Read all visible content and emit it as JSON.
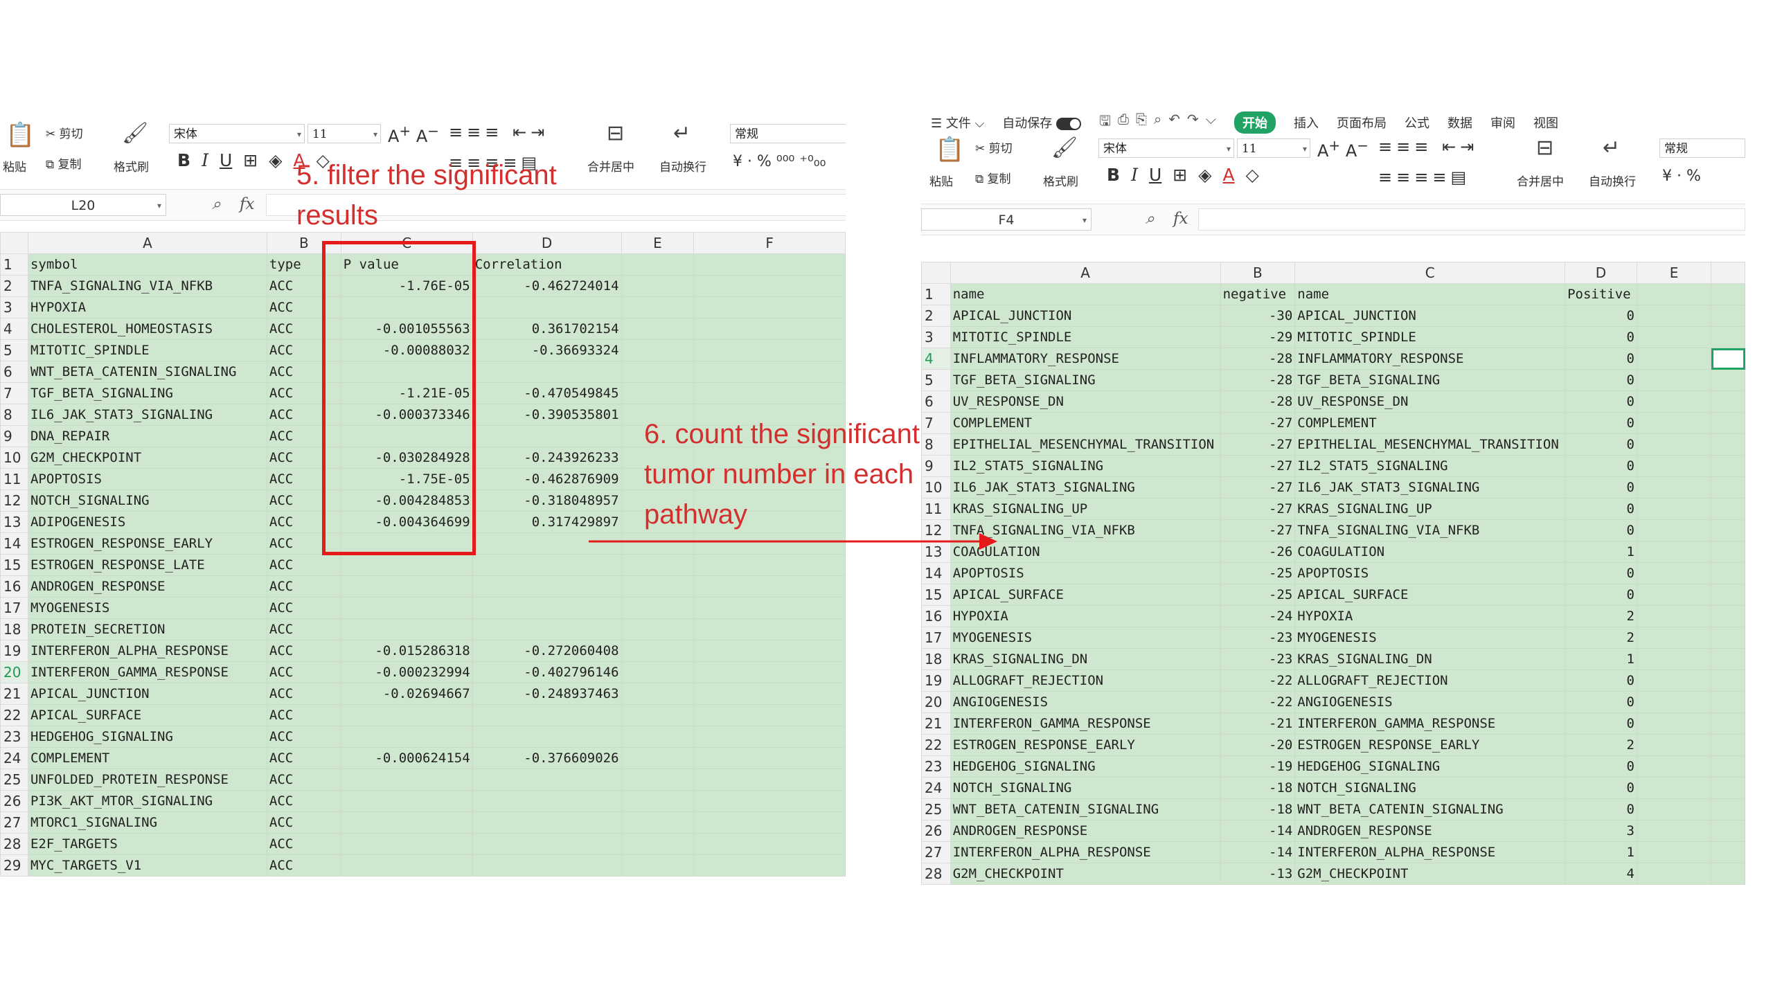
{
  "annotations": {
    "step5_line1": "5. filter the significant",
    "step5_line2": "results",
    "step6_line1": "6. count the significant",
    "step6_line2": "tumor number in each",
    "step6_line3": "pathway"
  },
  "colors": {
    "annotation": "#d32f2f",
    "highlight_box": "#e51a1a",
    "cell_fill": "#cfe7cf",
    "accent": "#21a366"
  },
  "left_sheet": {
    "ribbon": {
      "paste": "粘贴",
      "cut": "剪切",
      "copy": "复制",
      "format_painter": "格式刷",
      "font_name": "宋体",
      "font_size": "11",
      "merge_center": "合并居中",
      "wrap_text": "自动换行",
      "number_format": "常规"
    },
    "name_box": "L20",
    "col_headers": [
      "A",
      "B",
      "C",
      "D",
      "E",
      "F"
    ],
    "rows": [
      {
        "n": "1",
        "a": "symbol",
        "b": "type",
        "c": "P value",
        "d": "Correlation"
      },
      {
        "n": "2",
        "a": "TNFA_SIGNALING_VIA_NFKB",
        "b": "ACC",
        "c": "-1.76E-05",
        "d": "-0.462724014"
      },
      {
        "n": "3",
        "a": "HYPOXIA",
        "b": "ACC",
        "c": "",
        "d": ""
      },
      {
        "n": "4",
        "a": "CHOLESTEROL_HOMEOSTASIS",
        "b": "ACC",
        "c": "-0.001055563",
        "d": "0.361702154"
      },
      {
        "n": "5",
        "a": "MITOTIC_SPINDLE",
        "b": "ACC",
        "c": "-0.00088032",
        "d": "-0.36693324"
      },
      {
        "n": "6",
        "a": "WNT_BETA_CATENIN_SIGNALING",
        "b": "ACC",
        "c": "",
        "d": ""
      },
      {
        "n": "7",
        "a": "TGF_BETA_SIGNALING",
        "b": "ACC",
        "c": "-1.21E-05",
        "d": "-0.470549845"
      },
      {
        "n": "8",
        "a": "IL6_JAK_STAT3_SIGNALING",
        "b": "ACC",
        "c": "-0.000373346",
        "d": "-0.390535801"
      },
      {
        "n": "9",
        "a": "DNA_REPAIR",
        "b": "ACC",
        "c": "",
        "d": ""
      },
      {
        "n": "10",
        "a": "G2M_CHECKPOINT",
        "b": "ACC",
        "c": "-0.030284928",
        "d": "-0.243926233"
      },
      {
        "n": "11",
        "a": "APOPTOSIS",
        "b": "ACC",
        "c": "-1.75E-05",
        "d": "-0.462876909"
      },
      {
        "n": "12",
        "a": "NOTCH_SIGNALING",
        "b": "ACC",
        "c": "-0.004284853",
        "d": "-0.318048957"
      },
      {
        "n": "13",
        "a": "ADIPOGENESIS",
        "b": "ACC",
        "c": "-0.004364699",
        "d": "0.317429897"
      },
      {
        "n": "14",
        "a": "ESTROGEN_RESPONSE_EARLY",
        "b": "ACC",
        "c": "",
        "d": ""
      },
      {
        "n": "15",
        "a": "ESTROGEN_RESPONSE_LATE",
        "b": "ACC",
        "c": "",
        "d": ""
      },
      {
        "n": "16",
        "a": "ANDROGEN_RESPONSE",
        "b": "ACC",
        "c": "",
        "d": ""
      },
      {
        "n": "17",
        "a": "MYOGENESIS",
        "b": "ACC",
        "c": "",
        "d": ""
      },
      {
        "n": "18",
        "a": "PROTEIN_SECRETION",
        "b": "ACC",
        "c": "",
        "d": ""
      },
      {
        "n": "19",
        "a": "INTERFERON_ALPHA_RESPONSE",
        "b": "ACC",
        "c": "-0.015286318",
        "d": "-0.272060408"
      },
      {
        "n": "20",
        "a": "INTERFERON_GAMMA_RESPONSE",
        "b": "ACC",
        "c": "-0.000232994",
        "d": "-0.402796146"
      },
      {
        "n": "21",
        "a": "APICAL_JUNCTION",
        "b": "ACC",
        "c": "-0.02694667",
        "d": "-0.248937463"
      },
      {
        "n": "22",
        "a": "APICAL_SURFACE",
        "b": "ACC",
        "c": "",
        "d": ""
      },
      {
        "n": "23",
        "a": "HEDGEHOG_SIGNALING",
        "b": "ACC",
        "c": "",
        "d": ""
      },
      {
        "n": "24",
        "a": "COMPLEMENT",
        "b": "ACC",
        "c": "-0.000624154",
        "d": "-0.376609026"
      },
      {
        "n": "25",
        "a": "UNFOLDED_PROTEIN_RESPONSE",
        "b": "ACC",
        "c": "",
        "d": ""
      },
      {
        "n": "26",
        "a": "PI3K_AKT_MTOR_SIGNALING",
        "b": "ACC",
        "c": "",
        "d": ""
      },
      {
        "n": "27",
        "a": "MTORC1_SIGNALING",
        "b": "ACC",
        "c": "",
        "d": ""
      },
      {
        "n": "28",
        "a": "E2F_TARGETS",
        "b": "ACC",
        "c": "",
        "d": ""
      },
      {
        "n": "29",
        "a": "MYC_TARGETS_V1",
        "b": "ACC",
        "c": "",
        "d": ""
      }
    ],
    "selected_row": "20"
  },
  "right_sheet": {
    "menu": {
      "file": "文件",
      "autosave": "自动保存",
      "tabs": [
        "开始",
        "插入",
        "页面布局",
        "公式",
        "数据",
        "审阅",
        "视图"
      ]
    },
    "ribbon": {
      "paste": "粘贴",
      "cut": "剪切",
      "copy": "复制",
      "format_painter": "格式刷",
      "font_name": "宋体",
      "font_size": "11",
      "merge_center": "合并居中",
      "wrap_text": "自动换行",
      "number_format": "常规"
    },
    "name_box": "F4",
    "col_headers": [
      "A",
      "B",
      "C",
      "D",
      "E"
    ],
    "rows": [
      {
        "n": "1",
        "a": "name",
        "b": "negative",
        "c": "name",
        "d": "Positive"
      },
      {
        "n": "2",
        "a": "APICAL_JUNCTION",
        "b": "-30",
        "c": "APICAL_JUNCTION",
        "d": "0"
      },
      {
        "n": "3",
        "a": "MITOTIC_SPINDLE",
        "b": "-29",
        "c": "MITOTIC_SPINDLE",
        "d": "0"
      },
      {
        "n": "4",
        "a": "INFLAMMATORY_RESPONSE",
        "b": "-28",
        "c": "INFLAMMATORY_RESPONSE",
        "d": "0"
      },
      {
        "n": "5",
        "a": "TGF_BETA_SIGNALING",
        "b": "-28",
        "c": "TGF_BETA_SIGNALING",
        "d": "0"
      },
      {
        "n": "6",
        "a": "UV_RESPONSE_DN",
        "b": "-28",
        "c": "UV_RESPONSE_DN",
        "d": "0"
      },
      {
        "n": "7",
        "a": "COMPLEMENT",
        "b": "-27",
        "c": "COMPLEMENT",
        "d": "0"
      },
      {
        "n": "8",
        "a": "EPITHELIAL_MESENCHYMAL_TRANSITION",
        "b": "-27",
        "c": "EPITHELIAL_MESENCHYMAL_TRANSITION",
        "d": "0"
      },
      {
        "n": "9",
        "a": "IL2_STAT5_SIGNALING",
        "b": "-27",
        "c": "IL2_STAT5_SIGNALING",
        "d": "0"
      },
      {
        "n": "10",
        "a": "IL6_JAK_STAT3_SIGNALING",
        "b": "-27",
        "c": "IL6_JAK_STAT3_SIGNALING",
        "d": "0"
      },
      {
        "n": "11",
        "a": "KRAS_SIGNALING_UP",
        "b": "-27",
        "c": "KRAS_SIGNALING_UP",
        "d": "0"
      },
      {
        "n": "12",
        "a": "TNFA_SIGNALING_VIA_NFKB",
        "b": "-27",
        "c": "TNFA_SIGNALING_VIA_NFKB",
        "d": "0"
      },
      {
        "n": "13",
        "a": "COAGULATION",
        "b": "-26",
        "c": "COAGULATION",
        "d": "1"
      },
      {
        "n": "14",
        "a": "APOPTOSIS",
        "b": "-25",
        "c": "APOPTOSIS",
        "d": "0"
      },
      {
        "n": "15",
        "a": "APICAL_SURFACE",
        "b": "-25",
        "c": "APICAL_SURFACE",
        "d": "0"
      },
      {
        "n": "16",
        "a": "HYPOXIA",
        "b": "-24",
        "c": "HYPOXIA",
        "d": "2"
      },
      {
        "n": "17",
        "a": "MYOGENESIS",
        "b": "-23",
        "c": "MYOGENESIS",
        "d": "2"
      },
      {
        "n": "18",
        "a": "KRAS_SIGNALING_DN",
        "b": "-23",
        "c": "KRAS_SIGNALING_DN",
        "d": "1"
      },
      {
        "n": "19",
        "a": "ALLOGRAFT_REJECTION",
        "b": "-22",
        "c": "ALLOGRAFT_REJECTION",
        "d": "0"
      },
      {
        "n": "20",
        "a": "ANGIOGENESIS",
        "b": "-22",
        "c": "ANGIOGENESIS",
        "d": "0"
      },
      {
        "n": "21",
        "a": "INTERFERON_GAMMA_RESPONSE",
        "b": "-21",
        "c": "INTERFERON_GAMMA_RESPONSE",
        "d": "0"
      },
      {
        "n": "22",
        "a": "ESTROGEN_RESPONSE_EARLY",
        "b": "-20",
        "c": "ESTROGEN_RESPONSE_EARLY",
        "d": "2"
      },
      {
        "n": "23",
        "a": "HEDGEHOG_SIGNALING",
        "b": "-19",
        "c": "HEDGEHOG_SIGNALING",
        "d": "0"
      },
      {
        "n": "24",
        "a": "NOTCH_SIGNALING",
        "b": "-18",
        "c": "NOTCH_SIGNALING",
        "d": "0"
      },
      {
        "n": "25",
        "a": "WNT_BETA_CATENIN_SIGNALING",
        "b": "-18",
        "c": "WNT_BETA_CATENIN_SIGNALING",
        "d": "0"
      },
      {
        "n": "26",
        "a": "ANDROGEN_RESPONSE",
        "b": "-14",
        "c": "ANDROGEN_RESPONSE",
        "d": "3"
      },
      {
        "n": "27",
        "a": "INTERFERON_ALPHA_RESPONSE",
        "b": "-14",
        "c": "INTERFERON_ALPHA_RESPONSE",
        "d": "1"
      },
      {
        "n": "28",
        "a": "G2M_CHECKPOINT",
        "b": "-13",
        "c": "G2M_CHECKPOINT",
        "d": "4"
      }
    ],
    "selected_row": "4"
  }
}
